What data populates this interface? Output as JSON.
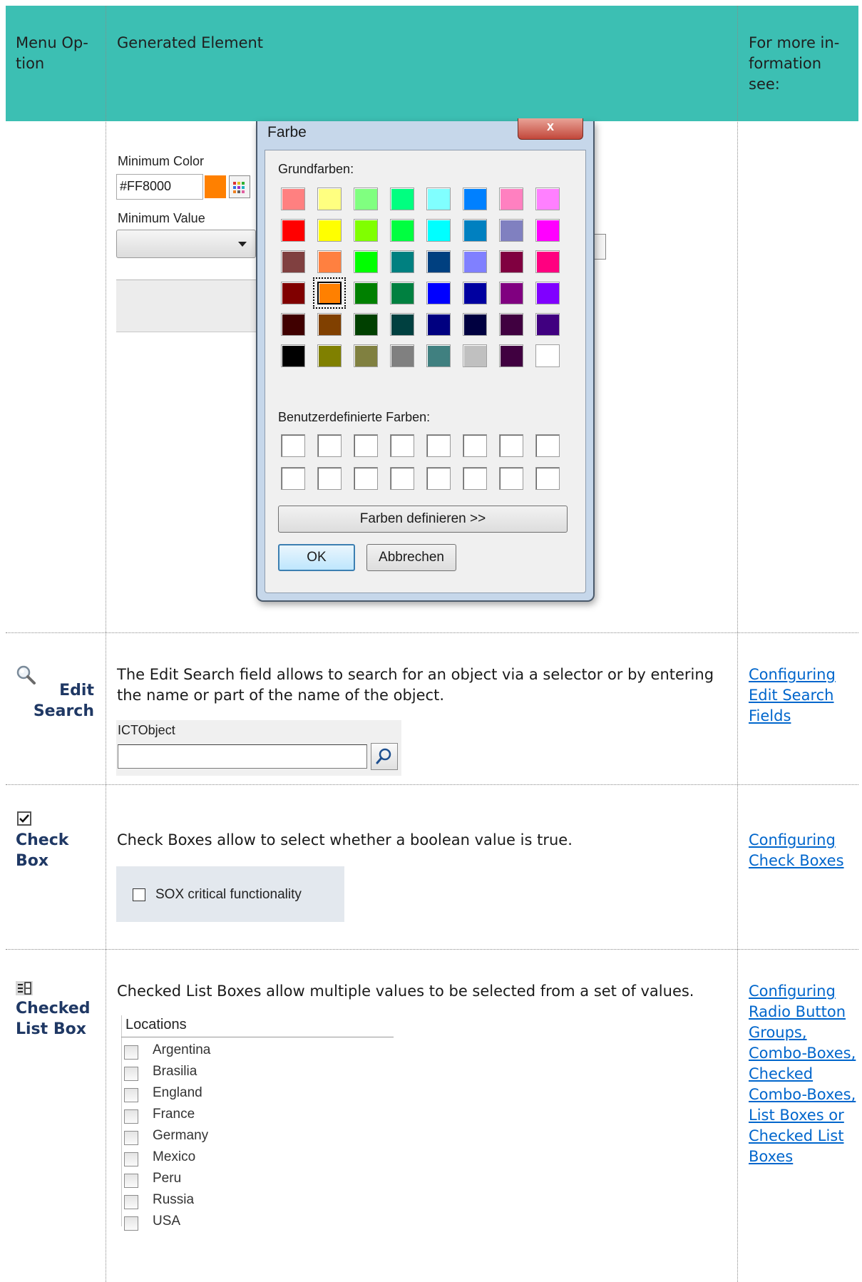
{
  "header": {
    "menu_option": "Menu Op-\ntion",
    "generated_element": "Generated Element",
    "more_info": "For more in-\nformation\nsee:"
  },
  "color_row": {
    "minimum_color_label": "Minimum Color",
    "minimum_color_value": "#FF8000",
    "minimum_value_label": "Minimum Value",
    "dialog": {
      "title": "Farbe",
      "close_label": "x",
      "basic_colors_label": "Grundfarben:",
      "custom_colors_label": "Benutzerdefinierte Farben:",
      "define_colors_button": "Farben definieren >>",
      "ok_button": "OK",
      "cancel_button": "Abbrechen",
      "selected_index": 25,
      "basic_colors": [
        "#ff8080",
        "#ffff80",
        "#80ff80",
        "#00ff80",
        "#80ffff",
        "#0080ff",
        "#ff80c0",
        "#ff80ff",
        "#ff0000",
        "#ffff00",
        "#80ff00",
        "#00ff40",
        "#00ffff",
        "#0080c0",
        "#8080c0",
        "#ff00ff",
        "#804040",
        "#ff8040",
        "#00ff00",
        "#008080",
        "#004080",
        "#8080ff",
        "#800040",
        "#ff0080",
        "#800000",
        "#ff8000",
        "#008000",
        "#008040",
        "#0000ff",
        "#0000a0",
        "#800080",
        "#8000ff",
        "#400000",
        "#804000",
        "#004000",
        "#004040",
        "#000080",
        "#000040",
        "#400040",
        "#400080",
        "#000000",
        "#808000",
        "#808040",
        "#808080",
        "#408080",
        "#c0c0c0",
        "#400040",
        "#ffffff"
      ]
    }
  },
  "edit_search_row": {
    "label": "Edit\nSearch",
    "description": "The Edit Search field allows to search for an object via a selector or by entering the name or part of the name of the object.",
    "field_label": "ICTObject",
    "link": "Configuring Edit Search Fields"
  },
  "check_box_row": {
    "label": "Check\nBox",
    "description": "Check Boxes allow to select whether a boolean value is true.",
    "checkbox_label": "SOX critical functionality",
    "link": "Configuring Check Boxes"
  },
  "checked_list_row": {
    "label": "Checked\nList Box",
    "description": "Checked List Boxes allow multiple values to be selected from a set of values.",
    "list_title": "Locations",
    "items": [
      "Argentina",
      "Brasilia",
      "England",
      "France",
      "Germany",
      "Mexico",
      "Peru",
      "Russia",
      "USA"
    ],
    "link": "Configuring Radio Button Groups, Combo-Boxes, Checked Combo-Boxes, List Boxes or Checked List Boxes"
  }
}
